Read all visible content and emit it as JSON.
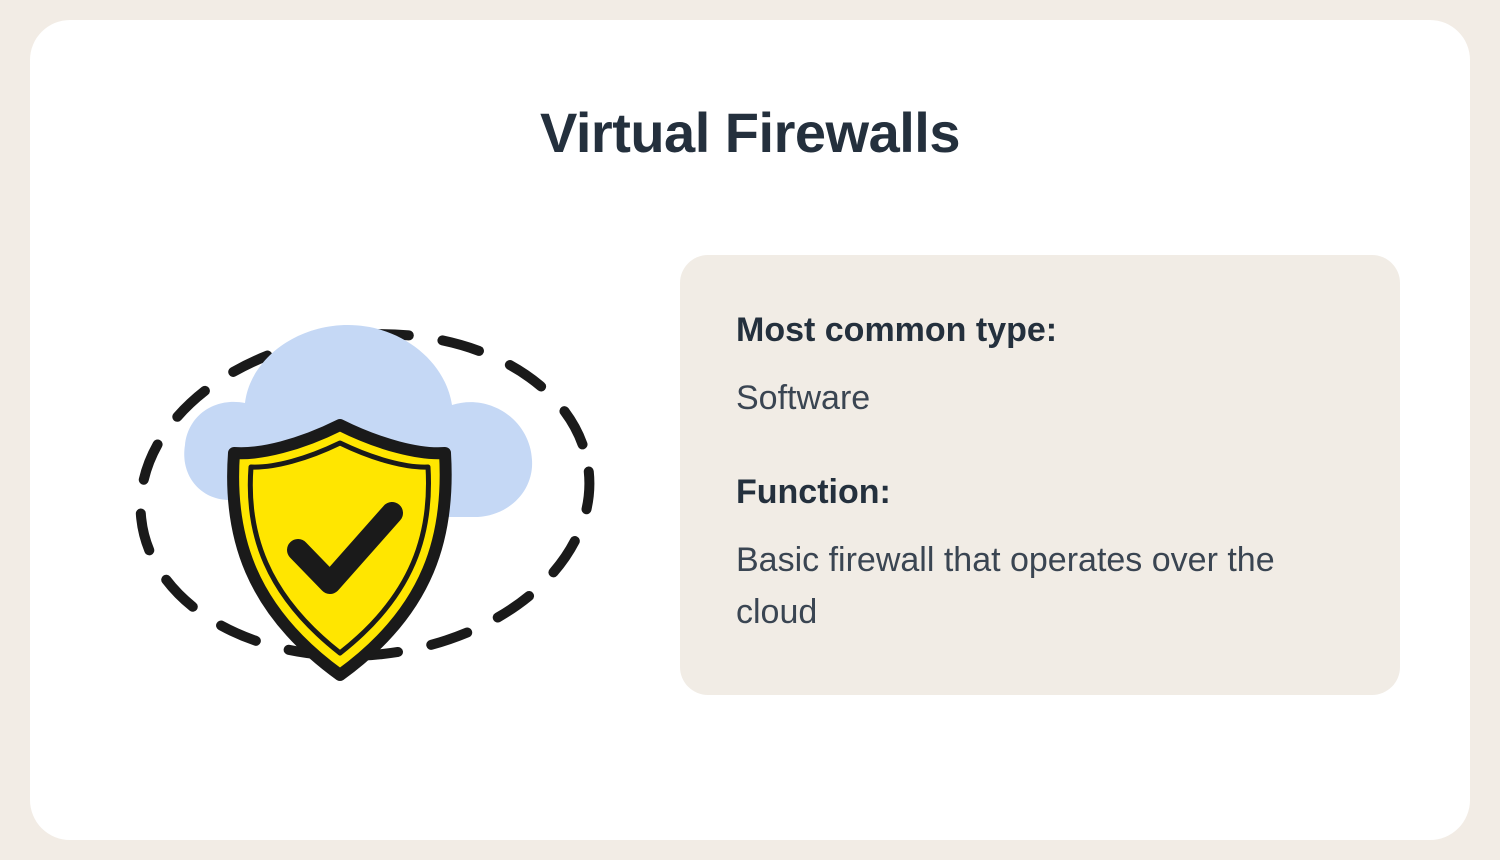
{
  "title": "Virtual Firewalls",
  "illustration": {
    "name": "cloud-shield-check-icon",
    "colors": {
      "cloud": "#c5d8f5",
      "shield": "#ffe600",
      "outline": "#1a1a1a",
      "check": "#1a1a1a"
    }
  },
  "info": {
    "type_label": "Most common type:",
    "type_value": "Software",
    "function_label": "Function:",
    "function_value": "Basic firewall that operates over the cloud"
  }
}
